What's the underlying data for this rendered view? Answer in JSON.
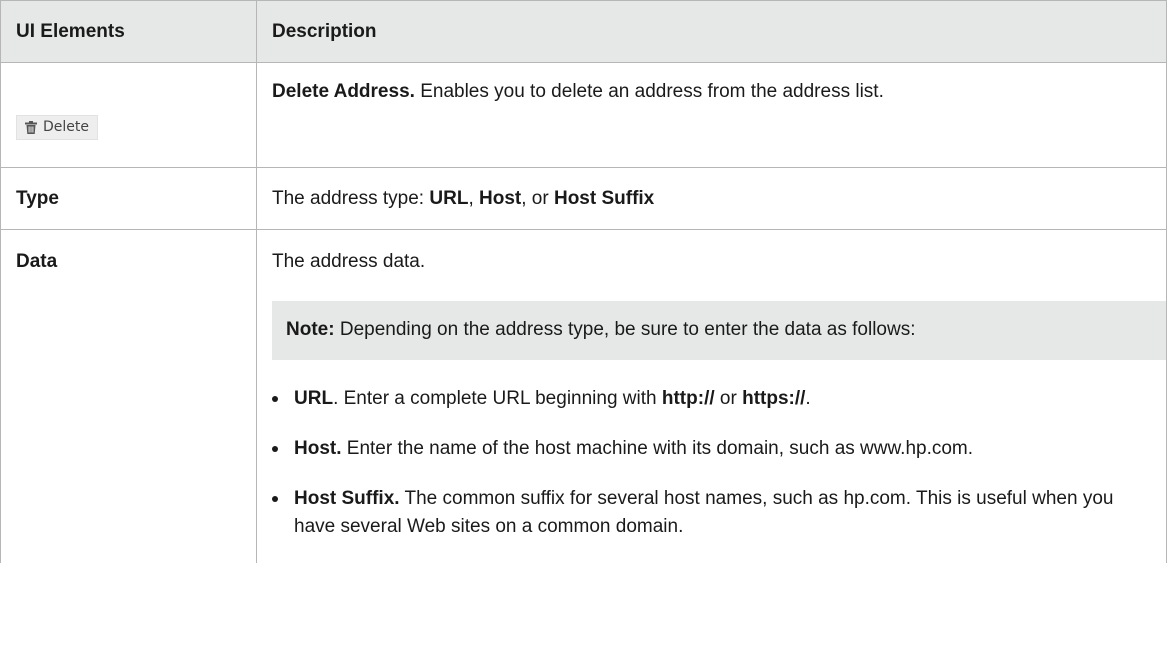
{
  "header": {
    "col_elements": "UI Elements",
    "col_description": "Description"
  },
  "rows": {
    "delete": {
      "button_label": "Delete",
      "icon": "trash-icon",
      "desc_title": "Delete Address.",
      "desc_text": "Enables you to delete an address from the address list."
    },
    "type": {
      "element": "Type",
      "desc_prefix": "The address type: ",
      "opt_url": "URL",
      "sep1": ", ",
      "opt_host": "Host",
      "sep2": ", or ",
      "opt_suffix": "Host Suffix"
    },
    "data": {
      "element": "Data",
      "desc_text": "The address data.",
      "note_label": "Note:",
      "note_text": "Depending on the address type, be sure to enter the data as follows:",
      "bullets": [
        {
          "title": "URL",
          "text_a": ". Enter a complete URL beginning with ",
          "code_a": "http://",
          "text_b": " or ",
          "code_b": "https://",
          "text_c": "."
        },
        {
          "title": "Host.",
          "text": "Enter the name of the host machine with its domain, such as www.hp.com."
        },
        {
          "title": "Host Suffix.",
          "text": "The common suffix for several host names, such as hp.com. This is useful when you have several Web sites on a common domain."
        }
      ]
    }
  },
  "colors": {
    "header_bg": "#e6e8e8",
    "border": "#b6b6b6",
    "note_bg": "#e6e8e8"
  }
}
